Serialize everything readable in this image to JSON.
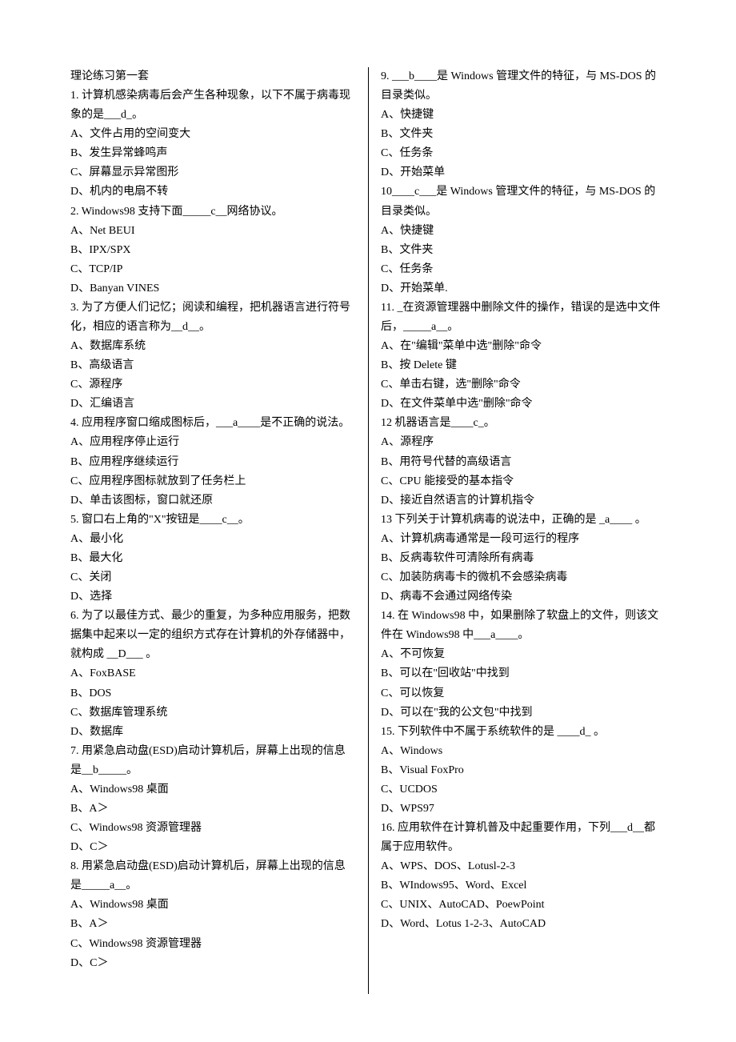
{
  "title": "理论练习第一套",
  "lines": [
    "理论练习第一套",
    "1. 计算机感染病毒后会产生各种现象，以下不属于病毒现象的是___d_。",
    "A、文件占用的空间变大",
    "B、发生异常蜂鸣声",
    "C、屏幕显示异常图形",
    "D、机内的电扇不转",
    "2. Windows98 支持下面_____c__网络协议。",
    "A、Net BEUI",
    "B、IPX/SPX",
    "C、TCP/IP",
    "D、Banyan VINES",
    "3. 为了方便人们记忆；阅读和编程，把机器语言进行符号化，相应的语言称为__d__。",
    "A、数据库系统",
    "B、高级语言",
    "C、源程序",
    "D、汇编语言",
    "4. 应用程序窗口缩成图标后，___a____是不正确的说法。",
    "A、应用程序停止运行",
    "B、应用程序继续运行",
    "C、应用程序图标就放到了任务栏上",
    "D、单击该图标，窗口就还原",
    "5. 窗口右上角的\"X\"按钮是____c__。",
    "A、最小化",
    "B、最大化",
    "C、关闭",
    "D、选择",
    "6. 为了以最佳方式、最少的重复，为多种应用服务，把数据集中起来以一定的组织方式存在计算机的外存储器中，就构成 __D___ 。",
    "A、FoxBASE",
    "B、DOS",
    "C、数据库管理系统",
    "D、数据库",
    "7. 用紧急启动盘(ESD)启动计算机后，屏幕上出现的信息是__b_____。",
    "A、Windows98 桌面",
    "B、A＞",
    "C、Windows98 资源管理器",
    "D、C＞",
    "8. 用紧急启动盘(ESD)启动计算机后，屏幕上出现的信息是_____a__。",
    "A、Windows98 桌面",
    "B、A＞",
    "C、Windows98 资源管理器",
    "D、C＞",
    "9. ___b____是 Windows 管理文件的特征，与 MS-DOS 的目录类似。",
    "A、快捷键",
    "B、文件夹",
    "C、任务条",
    "D、开始菜单",
    "10____c___是 Windows 管理文件的特征，与 MS-DOS 的目录类似。",
    "A、快捷键",
    "B、文件夹",
    "C、任务条",
    "D、开始菜单.",
    "11. _在资源管理器中删除文件的操作，错误的是选中文件后，_____a__。",
    "A、在\"编辑\"菜单中选\"删除\"命令",
    "B、按 Delete 键",
    "C、单击右键，选\"删除\"命令",
    "D、在文件菜单中选\"删除\"命令",
    "12 机器语言是____c_。",
    "A、源程序",
    "B、用符号代替的高级语言",
    "C、CPU 能接受的基本指令",
    "D、接近自然语言的计算机指令",
    "13 下列关于计算机病毒的说法中，正确的是 _a____ 。",
    "A、计算机病毒通常是一段可运行的程序",
    "B、反病毒软件可清除所有病毒",
    "C、加装防病毒卡的微机不会感染病毒",
    "D、病毒不会通过网络传染",
    "14. 在 Windows98 中，如果删除了软盘上的文件，则该文件在 Windows98 中___a____。",
    "A、不可恢复",
    "B、可以在\"回收站\"中找到",
    "C、可以恢复",
    "D、可以在\"我的公文包\"中找到",
    "15. 下列软件中不属于系统软件的是 ____d_ 。",
    "A、Windows",
    "B、Visual FoxPro",
    "C、UCDOS",
    "D、WPS97",
    "16. 应用软件在计算机普及中起重要作用，下列___d__都属于应用软件。",
    "A、WPS、DOS、Lotusl-2-3",
    "B、WIndows95、Word、Excel",
    "C、UNIX、AutoCAD、PoewPoint",
    "D、Word、Lotus 1-2-3、AutoCAD"
  ]
}
